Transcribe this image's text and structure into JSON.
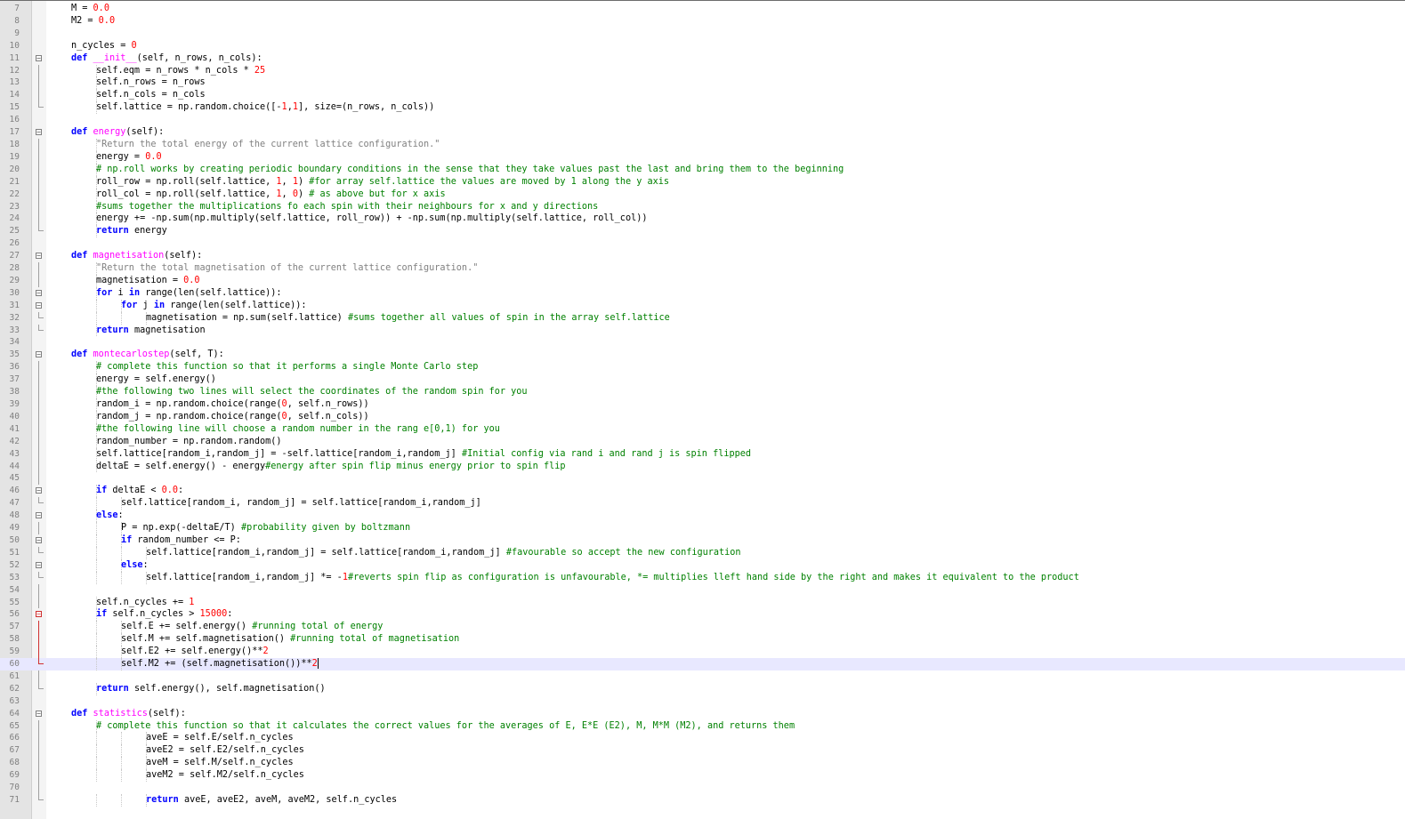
{
  "editor": {
    "current_line": 60,
    "lines": [
      {
        "n": "7",
        "fold": "",
        "indent": 1,
        "t": [
          [
            "M = ",
            ""
          ],
          [
            "0.0",
            "num"
          ]
        ]
      },
      {
        "n": "8",
        "fold": "",
        "indent": 1,
        "t": [
          [
            "M2 = ",
            ""
          ],
          [
            "0.0",
            "num"
          ]
        ]
      },
      {
        "n": "9",
        "fold": "",
        "indent": 0,
        "t": []
      },
      {
        "n": "10",
        "fold": "",
        "indent": 1,
        "t": [
          [
            "n_cycles = ",
            ""
          ],
          [
            "0",
            "num"
          ]
        ]
      },
      {
        "n": "11",
        "fold": "open",
        "indent": 1,
        "t": [
          [
            "def ",
            "kw"
          ],
          [
            "__init__",
            "fn"
          ],
          [
            "(self, n_rows, n_cols):",
            ""
          ]
        ]
      },
      {
        "n": "12",
        "fold": "line",
        "indent": 2,
        "t": [
          [
            "self.eqm = n_rows * n_cols * ",
            ""
          ],
          [
            "25",
            "num"
          ]
        ]
      },
      {
        "n": "13",
        "fold": "line",
        "indent": 2,
        "t": [
          [
            "self.n_rows = n_rows",
            ""
          ]
        ]
      },
      {
        "n": "14",
        "fold": "line",
        "indent": 2,
        "t": [
          [
            "self.n_cols = n_cols",
            ""
          ]
        ]
      },
      {
        "n": "15",
        "fold": "end",
        "indent": 2,
        "t": [
          [
            "self.lattice = np.random.choice([-",
            ""
          ],
          [
            "1",
            "num"
          ],
          [
            ",",
            ""
          ],
          [
            "1",
            "num"
          ],
          [
            "], size=(n_rows, n_cols))",
            ""
          ]
        ]
      },
      {
        "n": "16",
        "fold": "",
        "indent": 0,
        "t": []
      },
      {
        "n": "17",
        "fold": "open",
        "indent": 1,
        "t": [
          [
            "def ",
            "kw"
          ],
          [
            "energy",
            "fn"
          ],
          [
            "(self):",
            ""
          ]
        ]
      },
      {
        "n": "18",
        "fold": "line",
        "indent": 2,
        "t": [
          [
            "\"Return the total energy of the current lattice configuration.\"",
            "st"
          ]
        ]
      },
      {
        "n": "19",
        "fold": "line",
        "indent": 2,
        "t": [
          [
            "energy = ",
            ""
          ],
          [
            "0.0",
            "num"
          ]
        ]
      },
      {
        "n": "20",
        "fold": "line",
        "indent": 2,
        "t": [
          [
            "# np.roll works by creating periodic boundary conditions in the sense that they take values past the last and bring them to the beginning",
            "cm"
          ]
        ]
      },
      {
        "n": "21",
        "fold": "line",
        "indent": 2,
        "t": [
          [
            "roll_row = np.roll(self.lattice, ",
            ""
          ],
          [
            "1",
            "num"
          ],
          [
            ", ",
            ""
          ],
          [
            "1",
            "num"
          ],
          [
            ") ",
            ""
          ],
          [
            "#for array self.lattice the values are moved by 1 along the y axis",
            "cm"
          ]
        ]
      },
      {
        "n": "22",
        "fold": "line",
        "indent": 2,
        "t": [
          [
            "roll_col = np.roll(self.lattice, ",
            ""
          ],
          [
            "1",
            "num"
          ],
          [
            ", ",
            ""
          ],
          [
            "0",
            "num"
          ],
          [
            ") ",
            ""
          ],
          [
            "# as above but for x axis",
            "cm"
          ]
        ]
      },
      {
        "n": "23",
        "fold": "line",
        "indent": 2,
        "t": [
          [
            "#sums together the multiplications fo each spin with their neighbours for x and y directions",
            "cm"
          ]
        ]
      },
      {
        "n": "24",
        "fold": "line",
        "indent": 2,
        "t": [
          [
            "energy += -np.sum(np.multiply(self.lattice, roll_row)) + -np.sum(np.multiply(self.lattice, roll_col))",
            ""
          ]
        ]
      },
      {
        "n": "25",
        "fold": "end",
        "indent": 2,
        "t": [
          [
            "return ",
            "kw"
          ],
          [
            "energy",
            ""
          ]
        ]
      },
      {
        "n": "26",
        "fold": "",
        "indent": 0,
        "t": []
      },
      {
        "n": "27",
        "fold": "open",
        "indent": 1,
        "t": [
          [
            "def ",
            "kw"
          ],
          [
            "magnetisation",
            "fn"
          ],
          [
            "(self):",
            ""
          ]
        ]
      },
      {
        "n": "28",
        "fold": "line",
        "indent": 2,
        "t": [
          [
            "\"Return the total magnetisation of the current lattice configuration.\"",
            "st"
          ]
        ]
      },
      {
        "n": "29",
        "fold": "line",
        "indent": 2,
        "t": [
          [
            "magnetisation = ",
            ""
          ],
          [
            "0.0",
            "num"
          ]
        ]
      },
      {
        "n": "30",
        "fold": "open",
        "indent": 2,
        "t": [
          [
            "for ",
            "kw"
          ],
          [
            "i ",
            ""
          ],
          [
            "in ",
            "kw"
          ],
          [
            "range(len(self.lattice)):",
            ""
          ]
        ]
      },
      {
        "n": "31",
        "fold": "open",
        "indent": 3,
        "t": [
          [
            "for ",
            "kw"
          ],
          [
            "j ",
            ""
          ],
          [
            "in ",
            "kw"
          ],
          [
            "range(len(self.lattice)):",
            ""
          ]
        ]
      },
      {
        "n": "32",
        "fold": "end",
        "indent": 4,
        "t": [
          [
            "magnetisation = np.sum(self.lattice) ",
            ""
          ],
          [
            "#sums together all values of spin in the array self.lattice",
            "cm"
          ]
        ]
      },
      {
        "n": "33",
        "fold": "end",
        "indent": 2,
        "t": [
          [
            "return ",
            "kw"
          ],
          [
            "magnetisation",
            ""
          ]
        ]
      },
      {
        "n": "34",
        "fold": "",
        "indent": 0,
        "t": []
      },
      {
        "n": "35",
        "fold": "open",
        "indent": 1,
        "t": [
          [
            "def ",
            "kw"
          ],
          [
            "montecarlostep",
            "fn"
          ],
          [
            "(self, T):",
            ""
          ]
        ]
      },
      {
        "n": "36",
        "fold": "line",
        "indent": 2,
        "t": [
          [
            "# complete this function so that it performs a single Monte Carlo step",
            "cm"
          ]
        ]
      },
      {
        "n": "37",
        "fold": "line",
        "indent": 2,
        "t": [
          [
            "energy = self.energy()",
            ""
          ]
        ]
      },
      {
        "n": "38",
        "fold": "line",
        "indent": 2,
        "t": [
          [
            "#the following two lines will select the coordinates of the random spin for you",
            "cm"
          ]
        ]
      },
      {
        "n": "39",
        "fold": "line",
        "indent": 2,
        "t": [
          [
            "random_i = np.random.choice(range(",
            ""
          ],
          [
            "0",
            "num"
          ],
          [
            ", self.n_rows))",
            ""
          ]
        ]
      },
      {
        "n": "40",
        "fold": "line",
        "indent": 2,
        "t": [
          [
            "random_j = np.random.choice(range(",
            ""
          ],
          [
            "0",
            "num"
          ],
          [
            ", self.n_cols))",
            ""
          ]
        ]
      },
      {
        "n": "41",
        "fold": "line",
        "indent": 2,
        "t": [
          [
            "#the following line will choose a random number in the rang e[0,1) for you",
            "cm"
          ]
        ]
      },
      {
        "n": "42",
        "fold": "line",
        "indent": 2,
        "t": [
          [
            "random_number = np.random.random()",
            ""
          ]
        ]
      },
      {
        "n": "43",
        "fold": "line",
        "indent": 2,
        "t": [
          [
            "self.lattice[random_i,random_j] = -self.lattice[random_i,random_j] ",
            ""
          ],
          [
            "#Initial config via rand i and rand j is spin flipped",
            "cm"
          ]
        ]
      },
      {
        "n": "44",
        "fold": "line",
        "indent": 2,
        "t": [
          [
            "deltaE = self.energy() - energy",
            ""
          ],
          [
            "#energy after spin flip minus energy prior to spin flip",
            "cm"
          ]
        ]
      },
      {
        "n": "45",
        "fold": "line",
        "indent": 0,
        "t": []
      },
      {
        "n": "46",
        "fold": "open",
        "indent": 2,
        "t": [
          [
            "if ",
            "kw"
          ],
          [
            "deltaE < ",
            ""
          ],
          [
            "0.0",
            "num"
          ],
          [
            ":",
            ""
          ]
        ]
      },
      {
        "n": "47",
        "fold": "end",
        "indent": 3,
        "t": [
          [
            "self.lattice[random_i, random_j] = self.lattice[random_i,random_j]",
            ""
          ]
        ]
      },
      {
        "n": "48",
        "fold": "open",
        "indent": 2,
        "t": [
          [
            "else",
            "kw"
          ],
          [
            ":",
            ""
          ]
        ]
      },
      {
        "n": "49",
        "fold": "line",
        "indent": 3,
        "t": [
          [
            "P = np.exp(-deltaE/T) ",
            ""
          ],
          [
            "#probability given by boltzmann",
            "cm"
          ]
        ]
      },
      {
        "n": "50",
        "fold": "open",
        "indent": 3,
        "t": [
          [
            "if ",
            "kw"
          ],
          [
            "random_number <= P:",
            ""
          ]
        ]
      },
      {
        "n": "51",
        "fold": "end",
        "indent": 4,
        "t": [
          [
            "self.lattice[random_i,random_j] = self.lattice[random_i,random_j] ",
            ""
          ],
          [
            "#favourable so accept the new configuration",
            "cm"
          ]
        ]
      },
      {
        "n": "52",
        "fold": "open",
        "indent": 3,
        "t": [
          [
            "else",
            "kw"
          ],
          [
            ":",
            ""
          ]
        ]
      },
      {
        "n": "53",
        "fold": "end",
        "indent": 4,
        "t": [
          [
            "self.lattice[random_i,random_j] *= -",
            ""
          ],
          [
            "1",
            "num"
          ],
          [
            "#reverts spin flip as configuration is unfavourable, *= multiplies lleft hand side by the right and makes it equivalent to the product",
            "cm"
          ]
        ]
      },
      {
        "n": "54",
        "fold": "line",
        "indent": 0,
        "t": []
      },
      {
        "n": "55",
        "fold": "line",
        "indent": 2,
        "t": [
          [
            "self.n_cycles += ",
            ""
          ],
          [
            "1",
            "num"
          ]
        ]
      },
      {
        "n": "56",
        "fold": "openred",
        "indent": 2,
        "t": [
          [
            "if ",
            "kw"
          ],
          [
            "self.n_cycles > ",
            ""
          ],
          [
            "15000",
            "num"
          ],
          [
            ":",
            ""
          ]
        ]
      },
      {
        "n": "57",
        "fold": "linered",
        "indent": 3,
        "t": [
          [
            "self.E += self.energy() ",
            ""
          ],
          [
            "#running total of energy",
            "cm"
          ]
        ]
      },
      {
        "n": "58",
        "fold": "linered",
        "indent": 3,
        "t": [
          [
            "self.M += self.magnetisation() ",
            ""
          ],
          [
            "#running total of magnetisation",
            "cm"
          ]
        ]
      },
      {
        "n": "59",
        "fold": "linered",
        "indent": 3,
        "t": [
          [
            "self.E2 += self.energy()**",
            ""
          ],
          [
            "2",
            "num"
          ]
        ]
      },
      {
        "n": "60",
        "fold": "endred",
        "indent": 3,
        "t": [
          [
            "self.M2 += (self.magnetisation())**",
            ""
          ],
          [
            "2",
            "num"
          ]
        ],
        "caret": true
      },
      {
        "n": "61",
        "fold": "line",
        "indent": 0,
        "t": []
      },
      {
        "n": "62",
        "fold": "end",
        "indent": 2,
        "t": [
          [
            "return ",
            "kw"
          ],
          [
            "self.energy(), self.magnetisation()",
            ""
          ]
        ]
      },
      {
        "n": "63",
        "fold": "",
        "indent": 0,
        "t": []
      },
      {
        "n": "64",
        "fold": "open",
        "indent": 1,
        "t": [
          [
            "def ",
            "kw"
          ],
          [
            "statistics",
            "fn"
          ],
          [
            "(self):",
            ""
          ]
        ]
      },
      {
        "n": "65",
        "fold": "line",
        "indent": 2,
        "t": [
          [
            "# complete this function so that it calculates the correct values for the averages of E, E*E (E2), M, M*M (M2), and returns them",
            "cm"
          ]
        ]
      },
      {
        "n": "66",
        "fold": "line",
        "indent": 4,
        "t": [
          [
            "aveE = self.E/self.n_cycles",
            ""
          ]
        ]
      },
      {
        "n": "67",
        "fold": "line",
        "indent": 4,
        "t": [
          [
            "aveE2 = self.E2/self.n_cycles",
            ""
          ]
        ]
      },
      {
        "n": "68",
        "fold": "line",
        "indent": 4,
        "t": [
          [
            "aveM = self.M/self.n_cycles",
            ""
          ]
        ]
      },
      {
        "n": "69",
        "fold": "line",
        "indent": 4,
        "t": [
          [
            "aveM2 = self.M2/self.n_cycles",
            ""
          ]
        ]
      },
      {
        "n": "70",
        "fold": "line",
        "indent": 0,
        "t": []
      },
      {
        "n": "71",
        "fold": "end",
        "indent": 4,
        "t": [
          [
            "return ",
            "kw"
          ],
          [
            "aveE, aveE2, aveM, aveM2, self.n_cycles",
            ""
          ]
        ]
      }
    ]
  }
}
